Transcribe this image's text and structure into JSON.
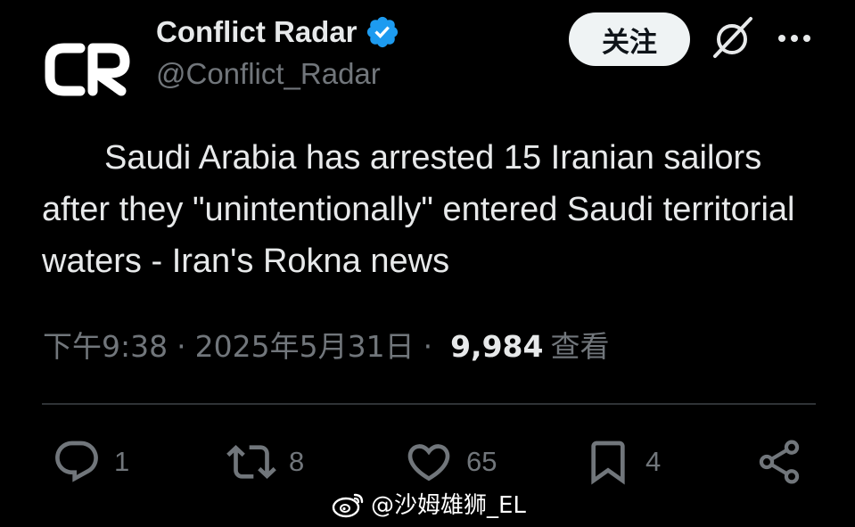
{
  "author": {
    "display_name": "Conflict Radar",
    "handle": "@Conflict_Radar",
    "avatar_icon": "conflict-radar-logo",
    "verified": true,
    "verified_color": "#1d9bf0"
  },
  "header_actions": {
    "follow_label": "关注",
    "grok_icon": "slashed-circle-icon",
    "more_icon": "ellipsis-icon"
  },
  "tweet": {
    "text": "Saudi Arabia has arrested 15 Iranian sailors after they \"unintentionally\" entered Saudi territorial waters - Iran's Rokna news"
  },
  "meta": {
    "time": "下午9:38",
    "separator": "·",
    "date": "2025年5月31日",
    "views_count": "9,984",
    "views_label": "查看"
  },
  "actions": {
    "reply_count": "1",
    "retweet_count": "8",
    "like_count": "65",
    "bookmark_count": "4"
  },
  "watermark": {
    "text": "@沙姆雄狮_EL",
    "icon": "weibo-icon"
  },
  "colors": {
    "background": "#000000",
    "primary_text": "#e7e9ea",
    "secondary_text": "#71767b",
    "divider": "#2f3336",
    "follow_bg": "#eff3f4"
  }
}
